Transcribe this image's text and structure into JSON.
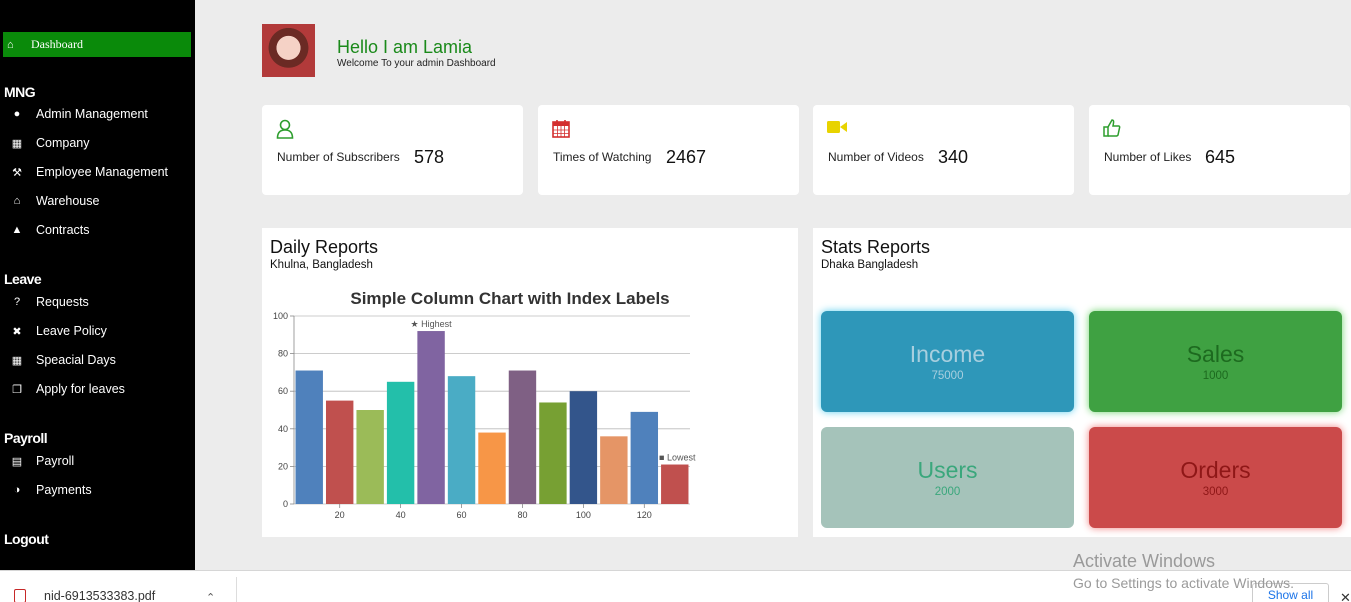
{
  "sidebar": {
    "dashboard_label": "Dashboard",
    "sections": [
      {
        "title": "MNG",
        "items": [
          {
            "label": "Admin Management",
            "icon": "user-icon"
          },
          {
            "label": "Company",
            "icon": "building-icon"
          },
          {
            "label": "Employee Management",
            "icon": "wrench-icon"
          },
          {
            "label": "Warehouse",
            "icon": "home-icon"
          },
          {
            "label": "Contracts",
            "icon": "thumbs-up-icon"
          }
        ]
      },
      {
        "title": "Leave",
        "items": [
          {
            "label": "Requests",
            "icon": "question-icon"
          },
          {
            "label": "Leave Policy",
            "icon": "times-circle-icon"
          },
          {
            "label": "Speacial Days",
            "icon": "calendar-icon"
          },
          {
            "label": "Apply for leaves",
            "icon": "copy-icon"
          }
        ]
      },
      {
        "title": "Payroll",
        "items": [
          {
            "label": "Payroll",
            "icon": "credit-card-icon"
          },
          {
            "label": "Payments",
            "icon": "adjust-icon"
          }
        ]
      }
    ],
    "logout_label": "Logout"
  },
  "header": {
    "greeting": "Hello I am Lamia",
    "welcome": "Welcome To your admin Dashboard"
  },
  "cards": [
    {
      "label": "Number of Subscribers",
      "value": "578",
      "icon": "user-outline-icon",
      "color": "#2e9e2e"
    },
    {
      "label": "Times of Watching",
      "value": "2467",
      "icon": "calendar-icon",
      "color": "#d32f2f"
    },
    {
      "label": "Number of Videos",
      "value": "340",
      "icon": "video-camera-icon",
      "color": "#e8d300"
    },
    {
      "label": "Number of Likes",
      "value": "645",
      "icon": "thumbs-up-outline-icon",
      "color": "#2e9e2e"
    }
  ],
  "daily": {
    "title": "Daily Reports",
    "subtitle": "Khulna, Bangladesh"
  },
  "chart_data": {
    "type": "bar",
    "title": "Simple Column Chart with Index Labels",
    "x": [
      10,
      20,
      30,
      40,
      50,
      60,
      70,
      80,
      90,
      100,
      110,
      120,
      130
    ],
    "values": [
      71,
      55,
      50,
      65,
      92,
      68,
      38,
      71,
      54,
      60,
      36,
      49,
      21
    ],
    "colors": [
      "#4f81bc",
      "#c0504e",
      "#9bbb58",
      "#23bfaa",
      "#8064a1",
      "#4aacc5",
      "#f79647",
      "#7f6084",
      "#77a033",
      "#33558b",
      "#e59566",
      "#4f81bc",
      "#c0504e"
    ],
    "annotations": [
      {
        "index": 4,
        "text": "★ Highest"
      },
      {
        "index": 12,
        "text": "■ Lowest"
      }
    ],
    "yticks": [
      0,
      20,
      40,
      60,
      80,
      100
    ],
    "xticks": [
      20,
      40,
      60,
      80,
      100,
      120
    ],
    "ylim": [
      0,
      100
    ],
    "grid": true
  },
  "stats": {
    "title": "Stats Reports",
    "subtitle": "Dhaka Bangladesh",
    "tiles": [
      {
        "name": "Income",
        "value": "75000",
        "bg": "#2e97b9",
        "fg": "#9fc9da"
      },
      {
        "name": "Sales",
        "value": "1000",
        "bg": "#3fa142",
        "fg": "#1d6a1f"
      },
      {
        "name": "Users",
        "value": "2000",
        "bg": "#a5c3ba",
        "fg": "#3aa77c"
      },
      {
        "name": "Orders",
        "value": "3000",
        "bg": "#cb4a4a",
        "fg": "#8f1717"
      }
    ]
  },
  "download": {
    "file_name": "nid-6913533383.pdf",
    "show_all": "Show all"
  },
  "watermark": {
    "line1": "Activate Windows",
    "line2": "Go to Settings to activate Windows."
  }
}
